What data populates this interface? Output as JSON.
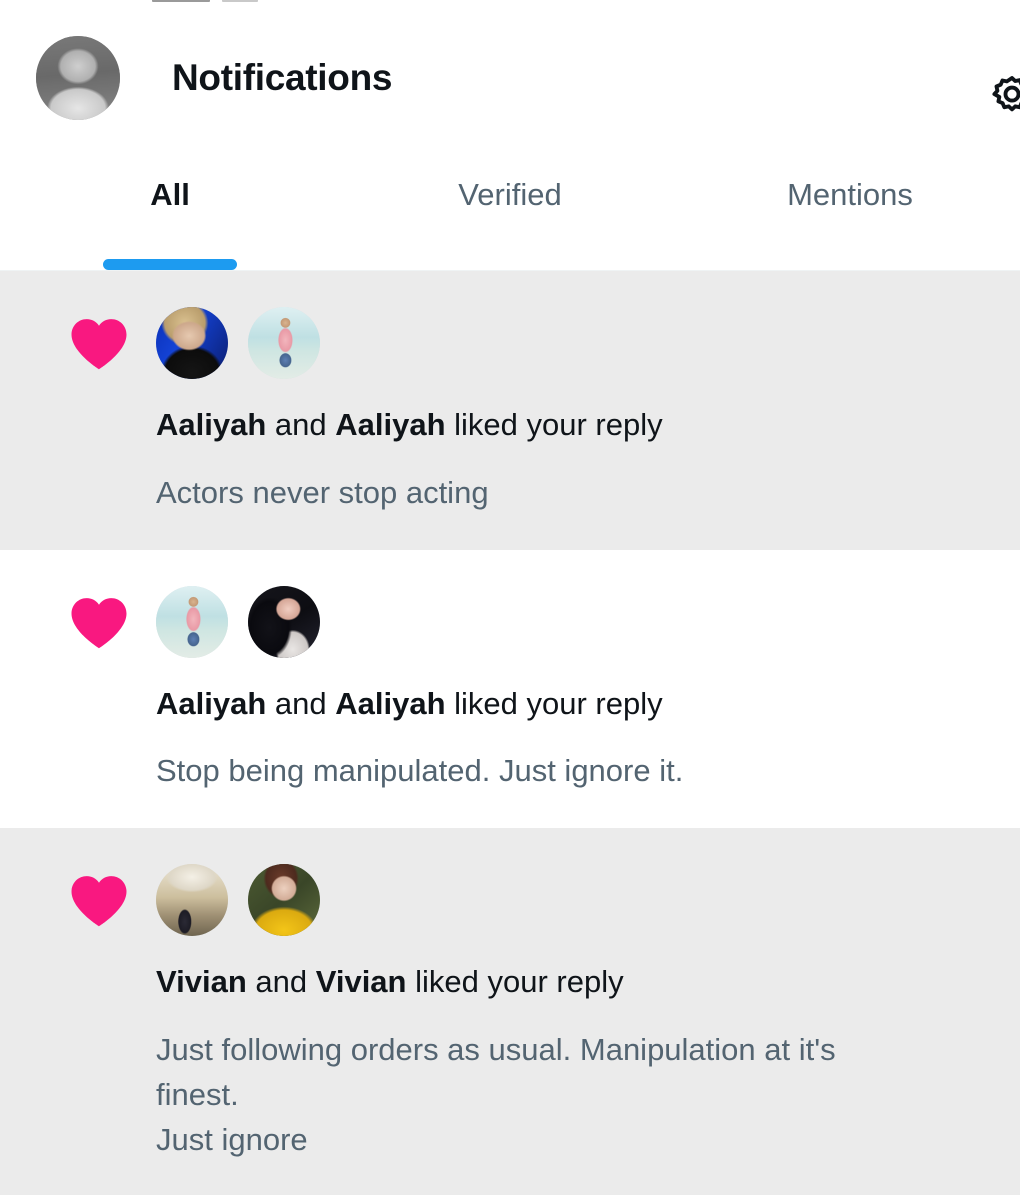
{
  "app": {
    "screen_name": "Notifications",
    "accent_blue": "#1D9BF0",
    "like_pink": "#F91880",
    "text_primary": "#0F1419",
    "text_secondary": "#536471",
    "row_alt_bg": "#EBEBEB",
    "row_bg": "#FFFFFF"
  },
  "header": {
    "title": "Notifications",
    "avatar_alt": "profile-photo",
    "settings_icon": "gear-icon"
  },
  "tabs": [
    {
      "label": "All",
      "active": true
    },
    {
      "label": "Verified",
      "active": false
    },
    {
      "label": "Mentions",
      "active": false
    }
  ],
  "notifications": [
    {
      "icon": "heart-icon",
      "avatar_count": 2,
      "actor_1": "Aaliyah",
      "conjunction": " and ",
      "actor_2": "Aaliyah",
      "action": " liked your reply",
      "body": "Actors never stop acting",
      "highlighted": true
    },
    {
      "icon": "heart-icon",
      "avatar_count": 2,
      "actor_1": "Aaliyah",
      "conjunction": " and ",
      "actor_2": "Aaliyah",
      "action": " liked your reply",
      "body": "Stop being manipulated. Just ignore it.",
      "highlighted": false
    },
    {
      "icon": "heart-icon",
      "avatar_count": 2,
      "actor_1": "Vivian",
      "conjunction": " and ",
      "actor_2": "Vivian",
      "action": " liked your reply",
      "body": "Just following orders as usual. Manipulation at it's finest.\nJust ignore",
      "highlighted": true
    }
  ]
}
